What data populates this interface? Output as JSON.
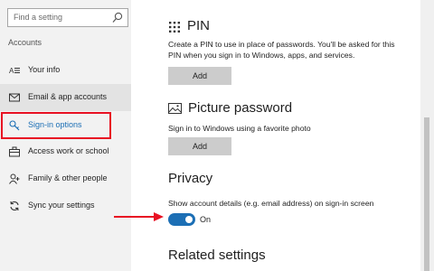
{
  "search": {
    "placeholder": "Find a setting",
    "icon": "search-icon"
  },
  "sidebar": {
    "heading": "Accounts",
    "items": [
      {
        "label": "Your info",
        "icon": "person-card-icon"
      },
      {
        "label": "Email & app accounts",
        "icon": "mail-icon"
      },
      {
        "label": "Sign-in options",
        "icon": "key-icon"
      },
      {
        "label": "Access work or school",
        "icon": "briefcase-icon"
      },
      {
        "label": "Family & other people",
        "icon": "add-person-icon"
      },
      {
        "label": "Sync your settings",
        "icon": "sync-icon"
      }
    ],
    "selected": "Sign-in options"
  },
  "main": {
    "pin": {
      "title": "PIN",
      "icon": "keypad-icon",
      "desc_line1": "Create a PIN to use in place of passwords. You'll be asked for this",
      "desc_line2": "PIN when you sign in to Windows, apps, and services.",
      "button": "Add"
    },
    "picture": {
      "title": "Picture password",
      "icon": "picture-icon",
      "desc": "Sign in to Windows using a favorite photo",
      "button": "Add"
    },
    "privacy": {
      "title": "Privacy",
      "desc": "Show account details (e.g. email address) on sign-in screen",
      "toggle_state": "On",
      "toggle_on": true
    },
    "related": {
      "title": "Related settings"
    }
  },
  "colors": {
    "accent": "#1c6fb5",
    "annotation": "#e81123"
  }
}
